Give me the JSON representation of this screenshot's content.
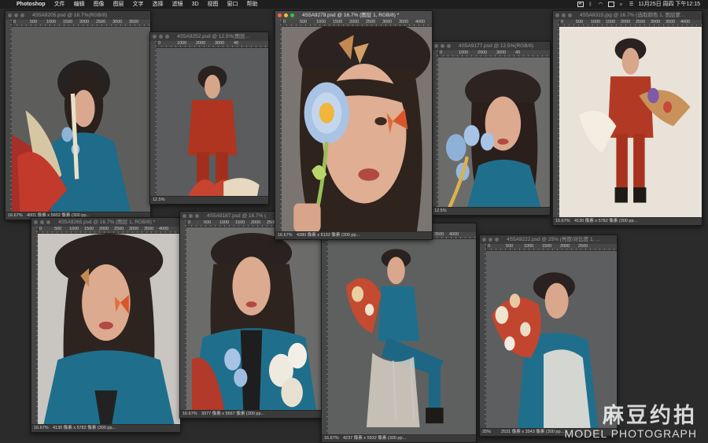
{
  "menubar": {
    "app_name": "Photoshop",
    "items": [
      "文件",
      "编辑",
      "图像",
      "图层",
      "文字",
      "选择",
      "滤镜",
      "3D",
      "视图",
      "窗口",
      "帮助"
    ],
    "clock": "11月25日 周四 下午12:15",
    "status_icons": [
      "input-method-icon",
      "bluetooth-icon",
      "wifi-icon",
      "battery-icon",
      "search-icon",
      "control-center-icon"
    ]
  },
  "windows": [
    {
      "title": "4S5A9205.psd @ 16.7%(RGB/8)",
      "ruler": [
        "0",
        "500",
        "1000",
        "1500",
        "2000",
        "2500",
        "3000",
        "3500"
      ],
      "zoom": "16.67%",
      "info": "4001 像素 x 5602 像素 (300 pp..."
    },
    {
      "title": "4S5A9252.psd @ 12.5%(图层...",
      "ruler": [
        "0",
        "1000",
        "2000",
        "3000",
        "40"
      ],
      "zoom": "12.5%",
      "info": ""
    },
    {
      "title": "4S5A9279.psd @ 16.7% (图层 1, RGB/8) *",
      "ruler": [
        "0",
        "500",
        "1000",
        "1500",
        "2000",
        "2500",
        "3000",
        "3500",
        "4000"
      ],
      "zoom": "16.67%",
      "info": "4380 像素 x 6132 像素 (300 pp..."
    },
    {
      "title": "4S5A9177.psd @ 12.5%(RGB/8)",
      "ruler": [
        "0",
        "1000",
        "2000",
        "3000",
        "40"
      ],
      "zoom": "12.5%",
      "info": ""
    },
    {
      "title": "4S5A9315.jpg @ 16.7% (选取颜色 1, 图层蒙...",
      "ruler": [
        "0",
        "500",
        "1000",
        "1500",
        "2000",
        "2500",
        "3000",
        "3500",
        "4000"
      ],
      "zoom": "16.67%",
      "info": "4130 像素 x 5782 像素 (300 pp..."
    },
    {
      "title": "4S5A9265.psd @ 16.7% (图层 1, RGB/8) *",
      "ruler": [
        "0",
        "500",
        "1000",
        "1500",
        "2000",
        "2500",
        "3000",
        "3500",
        "4000"
      ],
      "zoom": "16.67%",
      "info": "4130 像素 x 5782 像素 (300 pp..."
    },
    {
      "title": "4S5A9187.psd @ 16.7% (",
      "ruler": [
        "0",
        "500",
        "1000",
        "1500",
        "2000",
        "2500",
        "3000",
        "3500"
      ],
      "zoom": "16.67%",
      "info": "3977 像素 x 5567 像素 (300 pp..."
    },
    {
      "title": "1, RGB/8)",
      "ruler": [
        "0",
        "500",
        "1000",
        "1500",
        "2000",
        "2500",
        "3000",
        "3500",
        "4000"
      ],
      "zoom": "16.67%",
      "info": "4237 像素 x 5932 像素 (300 pp..."
    },
    {
      "title": "4S5A9222.psd @ 25% (亮度/对比度 1, ...",
      "ruler": [
        "0",
        "500",
        "1000",
        "1500",
        "2000",
        "2500"
      ],
      "zoom": "25%",
      "info": "2531 像素 x 3543 像素 (300 pp..."
    }
  ],
  "watermark": {
    "cn": "麻豆约拍",
    "en": "MODEL PHOTOGRAPH"
  },
  "colors": {
    "desktop": "#2b2b2b",
    "menubar": "#1e1e1e",
    "teal_suit": "#1f6f8c",
    "red_suit": "#b03520",
    "hat": "#2a2220"
  }
}
